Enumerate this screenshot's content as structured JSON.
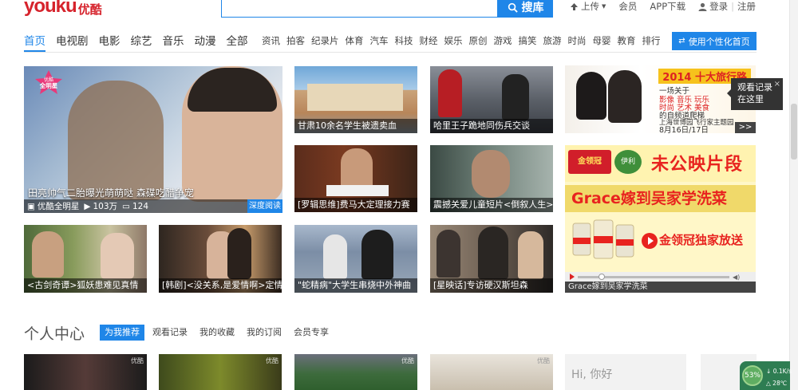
{
  "header": {
    "logo_text": "youku",
    "logo_cn": "优酷",
    "search_button": "搜库",
    "upload_label": "上传",
    "vip_label": "会员",
    "app_label": "APP下载",
    "login_label": "登录",
    "register_label": "注册"
  },
  "nav": {
    "main": [
      "首页",
      "电视剧",
      "电影",
      "综艺",
      "音乐",
      "动漫",
      "全部"
    ],
    "sub": [
      "资讯",
      "拍客",
      "纪录片",
      "体育",
      "汽车",
      "科技",
      "财经",
      "娱乐",
      "原创",
      "游戏",
      "搞笑",
      "旅游",
      "时尚",
      "母婴",
      "教育",
      "排行"
    ],
    "personal_button": "使用个性化首页"
  },
  "hero": {
    "badge_top": "优酷",
    "badge_bottom": "全明星",
    "title": "田亮帅气二胎曝光萌萌哒 森碟吃醋争宠",
    "channel": "优酷全明星",
    "views": "103万",
    "comments": "124",
    "deep_read": "深度阅读"
  },
  "cards": [
    "甘肃10余名学生被遗卖血",
    "哈里王子跪地同伤兵交谈",
    "[罗辑思维]费马大定理接力赛",
    "震撼关爱儿童短片<倒叙人生>",
    "<古剑奇谭>狐妖患难见真情",
    "[韩剧]<没关系,是爱情啊>定情",
    "\"蛇精病\"大学生串烧中外神曲",
    "[星映话]专访硬汉斯坦森"
  ],
  "ad_banner": {
    "header": "2014 十大旅行路",
    "line1": "一场关于",
    "line2": "影像 音乐 玩乐",
    "line3": "时尚 艺术 美食",
    "line4": "的自频道爬梯",
    "line5": "上海世博园飞行家主题园",
    "line6": "8月16日/17日",
    "more": ">>"
  },
  "watch_tip": {
    "line1": "观看记录",
    "line2": "在这里",
    "close": "×"
  },
  "grace_ad": {
    "brand": "金领冠",
    "logo2": "伊利",
    "slogan1": "未公映片段",
    "slogan2": "Grace嫁到吴家学洗菜",
    "ad_tag": "金领冠独家放送",
    "caption": "Grace嫁到吴家学洗菜"
  },
  "personal_center": {
    "title": "个人中心",
    "tabs": [
      "为我推荐",
      "观看记录",
      "我的收藏",
      "我的订阅",
      "会员专享"
    ],
    "hi_text": "Hi, 你好",
    "watermark": "优酷"
  },
  "net_widget": {
    "percent": "53%",
    "down": "0.1K/s",
    "up": "28℃"
  },
  "colors": {
    "accent": "#1f86e8",
    "brand_red": "#d6232c"
  }
}
